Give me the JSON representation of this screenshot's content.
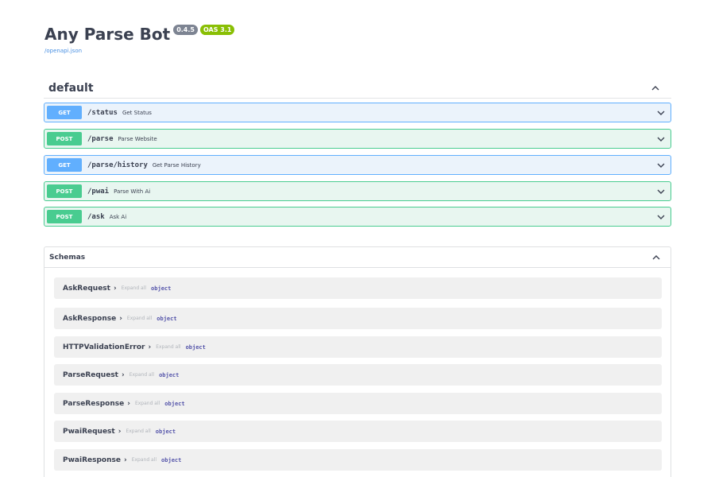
{
  "info": {
    "title": "Any Parse Bot",
    "version": "0.4.5",
    "oas": "OAS 3.1",
    "spec_link": "/openapi.json"
  },
  "tag": {
    "name": "default",
    "toggle_icon": "chevron-up-icon"
  },
  "operations": [
    {
      "method": "GET",
      "path": "/status",
      "summary": "Get Status"
    },
    {
      "method": "POST",
      "path": "/parse",
      "summary": "Parse Website"
    },
    {
      "method": "GET",
      "path": "/parse/history",
      "summary": "Get Parse History"
    },
    {
      "method": "POST",
      "path": "/pwai",
      "summary": "Parse With Ai"
    },
    {
      "method": "POST",
      "path": "/ask",
      "summary": "Ask Ai"
    }
  ],
  "schemas": {
    "title": "Schemas",
    "toggle_icon": "chevron-up-icon",
    "expand_label": "Expand all",
    "models": [
      {
        "name": "AskRequest",
        "type": "object"
      },
      {
        "name": "AskResponse",
        "type": "object"
      },
      {
        "name": "HTTPValidationError",
        "type": "object"
      },
      {
        "name": "ParseRequest",
        "type": "object"
      },
      {
        "name": "ParseResponse",
        "type": "object"
      },
      {
        "name": "PwaiRequest",
        "type": "object"
      },
      {
        "name": "PwaiResponse",
        "type": "object"
      }
    ]
  },
  "colors": {
    "get": "#61affe",
    "post": "#49cc90",
    "version_badge": "#7d8492",
    "oas_badge": "#89bf04",
    "link": "#4990e2"
  }
}
